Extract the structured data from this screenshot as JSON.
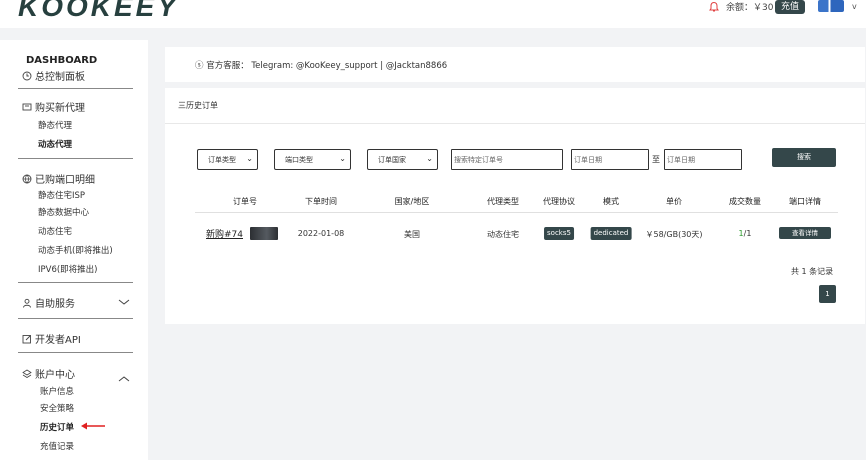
{
  "header": {
    "logo_text": "KOOKEEY",
    "balance_text": "余额：￥30",
    "recharge_label": "充值",
    "username": "v"
  },
  "sidebar": {
    "dashboard_title": "DASHBOARD",
    "dashboard_item": "总控制面板",
    "buy_proxy": {
      "label": "购买新代理",
      "items": [
        "静态代理",
        "动态代理"
      ]
    },
    "purchased_ports": {
      "label": "已购端口明细",
      "items": [
        "静态住宅ISP",
        "静态数据中心",
        "动态住宅",
        "动态手机(即将推出)",
        "IPV6(即将推出)"
      ]
    },
    "self_service": "自助服务",
    "developer_api": "开发者API",
    "account_center": {
      "label": "账户中心",
      "items": [
        "账户信息",
        "安全策略",
        "历史订单",
        "充值记录"
      ]
    }
  },
  "notice": {
    "text": "官方客服：  Telegram: @KooKeey_support | @Jacktan8866"
  },
  "main": {
    "title": "三历史订单",
    "filters": {
      "order_type": "订单类型",
      "port_type": "端口类型",
      "order_country": "订单国家",
      "order_id_placeholder": "搜索特定订单号",
      "date_from_placeholder": "订单日期",
      "to_label": "至",
      "date_to_placeholder": "订单日期",
      "search_label": "搜索"
    },
    "table": {
      "headers": [
        "订单号",
        "下单时间",
        "国家/地区",
        "代理类型",
        "代理协议",
        "模式",
        "单价",
        "成交数量",
        "端口详情"
      ],
      "rows": [
        {
          "order_no": "新购#74",
          "date": "2022-01-08",
          "country": "美国",
          "proxy_type": "动态住宅",
          "protocol": "socks5",
          "mode": "dedicated",
          "price": "￥58/GB(30天)",
          "qty_done": "1",
          "qty_total": "/1",
          "detail_label": "查看详情"
        }
      ]
    },
    "pagination": {
      "total_text": "共 1 条记录",
      "current_page": "1"
    }
  },
  "colors": {
    "accent": "#34474a",
    "qty_green": "#2e9b2e",
    "arrow_red": "#e02020"
  }
}
